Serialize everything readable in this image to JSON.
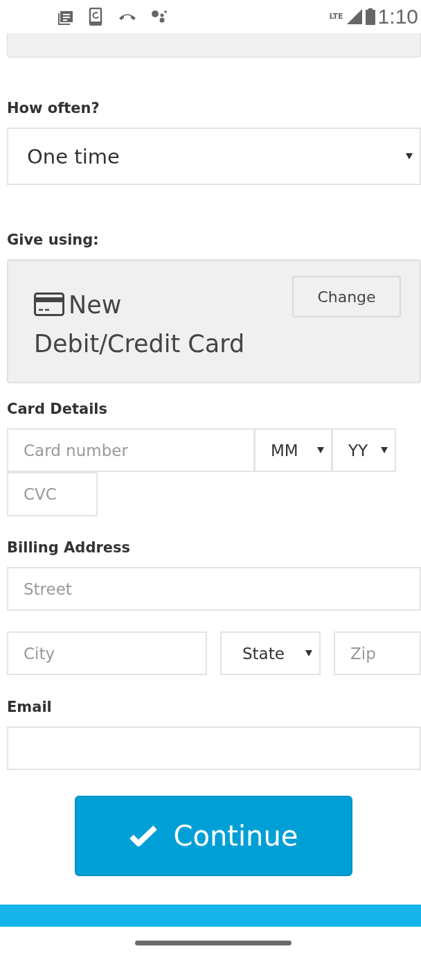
{
  "status_bar": {
    "network": "LTE",
    "time": "1:10"
  },
  "frequency": {
    "label": "How often?",
    "value": "One time"
  },
  "payment_method": {
    "label": "Give using:",
    "method": "New Debit/Credit Card",
    "change_button": "Change"
  },
  "card_details": {
    "label": "Card Details",
    "card_number": {
      "placeholder": "Card number"
    },
    "month": {
      "value": "MM"
    },
    "year": {
      "value": "YY"
    },
    "cvc": {
      "placeholder": "CVC"
    }
  },
  "billing_address": {
    "label": "Billing Address",
    "street": {
      "placeholder": "Street"
    },
    "city": {
      "placeholder": "City"
    },
    "state": {
      "value": "State"
    },
    "zip": {
      "placeholder": "Zip"
    }
  },
  "email": {
    "label": "Email"
  },
  "continue_button": "Continue"
}
